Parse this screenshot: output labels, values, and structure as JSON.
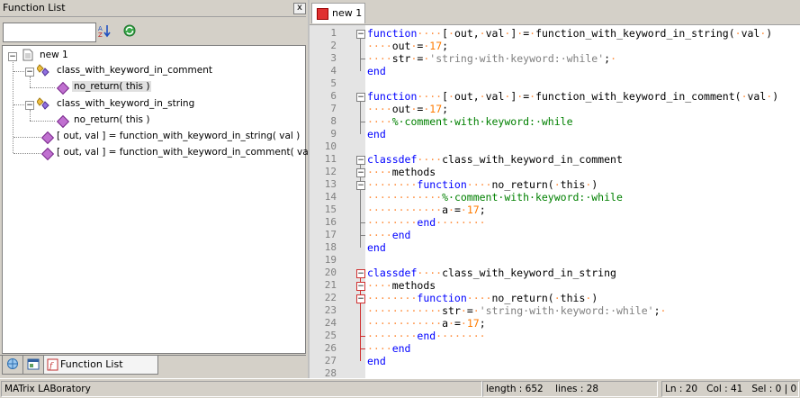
{
  "left_panel": {
    "title": "Function List",
    "close_label": "x",
    "search_value": "",
    "tree": {
      "root": "new 1",
      "classes": [
        {
          "label": "class_with_keyword_in_comment",
          "methods": [
            "no_return( this )"
          ]
        },
        {
          "label": "class_with_keyword_in_string",
          "methods": [
            "no_return( this )"
          ]
        }
      ],
      "functions": [
        "[ out, val ] = function_with_keyword_in_string( val )",
        "[ out, val ] = function_with_keyword_in_comment( val )"
      ]
    },
    "bottom_tabs": [
      {
        "icon": "globe-icon"
      },
      {
        "icon": "window-icon"
      },
      {
        "icon": "function-icon",
        "label": "Function List"
      }
    ]
  },
  "editor": {
    "tab_label": "new 1",
    "line_numbers": [
      "1",
      "2",
      "3",
      "4",
      "5",
      "6",
      "7",
      "8",
      "9",
      "10",
      "11",
      "12",
      "13",
      "14",
      "15",
      "16",
      "17",
      "18",
      "19",
      "20",
      "21",
      "22",
      "23",
      "24",
      "25",
      "26",
      "27",
      "28"
    ],
    "lines": [
      [
        {
          "t": "kw",
          "v": "function"
        },
        {
          "t": "dot",
          "v": "····"
        },
        {
          "t": "op",
          "v": "["
        },
        {
          "t": "dot",
          "v": "·"
        },
        {
          "t": "op",
          "v": "out,"
        },
        {
          "t": "dot",
          "v": "·"
        },
        {
          "t": "op",
          "v": "val"
        },
        {
          "t": "dot",
          "v": "·"
        },
        {
          "t": "op",
          "v": "]"
        },
        {
          "t": "dot",
          "v": "·"
        },
        {
          "t": "op",
          "v": "="
        },
        {
          "t": "dot",
          "v": "·"
        },
        {
          "t": "op",
          "v": "function_with_keyword_in_string("
        },
        {
          "t": "dot",
          "v": "·"
        },
        {
          "t": "op",
          "v": "val"
        },
        {
          "t": "dot",
          "v": "·"
        },
        {
          "t": "op",
          "v": ")"
        }
      ],
      [
        {
          "t": "dot",
          "v": "····"
        },
        {
          "t": "op",
          "v": "out"
        },
        {
          "t": "dot",
          "v": "·"
        },
        {
          "t": "op",
          "v": "="
        },
        {
          "t": "dot",
          "v": "·"
        },
        {
          "t": "num",
          "v": "17"
        },
        {
          "t": "op",
          "v": ";"
        }
      ],
      [
        {
          "t": "dot",
          "v": "····"
        },
        {
          "t": "op",
          "v": "str"
        },
        {
          "t": "dot",
          "v": "·"
        },
        {
          "t": "op",
          "v": "="
        },
        {
          "t": "dot",
          "v": "·"
        },
        {
          "t": "str",
          "v": "'string·with·keyword:·while'"
        },
        {
          "t": "op",
          "v": ";"
        },
        {
          "t": "dot",
          "v": "·"
        }
      ],
      [
        {
          "t": "kw",
          "v": "end"
        }
      ],
      [],
      [
        {
          "t": "kw",
          "v": "function"
        },
        {
          "t": "dot",
          "v": "····"
        },
        {
          "t": "op",
          "v": "["
        },
        {
          "t": "dot",
          "v": "·"
        },
        {
          "t": "op",
          "v": "out,"
        },
        {
          "t": "dot",
          "v": "·"
        },
        {
          "t": "op",
          "v": "val"
        },
        {
          "t": "dot",
          "v": "·"
        },
        {
          "t": "op",
          "v": "]"
        },
        {
          "t": "dot",
          "v": "·"
        },
        {
          "t": "op",
          "v": "="
        },
        {
          "t": "dot",
          "v": "·"
        },
        {
          "t": "op",
          "v": "function_with_keyword_in_comment("
        },
        {
          "t": "dot",
          "v": "·"
        },
        {
          "t": "op",
          "v": "val"
        },
        {
          "t": "dot",
          "v": "·"
        },
        {
          "t": "op",
          "v": ")"
        }
      ],
      [
        {
          "t": "dot",
          "v": "····"
        },
        {
          "t": "op",
          "v": "out"
        },
        {
          "t": "dot",
          "v": "·"
        },
        {
          "t": "op",
          "v": "="
        },
        {
          "t": "dot",
          "v": "·"
        },
        {
          "t": "num",
          "v": "17"
        },
        {
          "t": "op",
          "v": ";"
        }
      ],
      [
        {
          "t": "dot",
          "v": "····"
        },
        {
          "t": "cm",
          "v": "%·comment·with·keyword:·while"
        }
      ],
      [
        {
          "t": "kw",
          "v": "end"
        }
      ],
      [],
      [
        {
          "t": "kw",
          "v": "classdef"
        },
        {
          "t": "dot",
          "v": "····"
        },
        {
          "t": "op",
          "v": "class_with_keyword_in_comment"
        }
      ],
      [
        {
          "t": "dot",
          "v": "····"
        },
        {
          "t": "op",
          "v": "methods"
        }
      ],
      [
        {
          "t": "dot",
          "v": "········"
        },
        {
          "t": "kw",
          "v": "function"
        },
        {
          "t": "dot",
          "v": "····"
        },
        {
          "t": "op",
          "v": "no_return("
        },
        {
          "t": "dot",
          "v": "·"
        },
        {
          "t": "op",
          "v": "this"
        },
        {
          "t": "dot",
          "v": "·"
        },
        {
          "t": "op",
          "v": ")"
        }
      ],
      [
        {
          "t": "dot",
          "v": "············"
        },
        {
          "t": "cm",
          "v": "%·comment·with·keyword:·while"
        }
      ],
      [
        {
          "t": "dot",
          "v": "············"
        },
        {
          "t": "op",
          "v": "a"
        },
        {
          "t": "dot",
          "v": "·"
        },
        {
          "t": "op",
          "v": "="
        },
        {
          "t": "dot",
          "v": "·"
        },
        {
          "t": "num",
          "v": "17"
        },
        {
          "t": "op",
          "v": ";"
        }
      ],
      [
        {
          "t": "dot",
          "v": "········"
        },
        {
          "t": "kw",
          "v": "end"
        },
        {
          "t": "dot",
          "v": "········"
        }
      ],
      [
        {
          "t": "dot",
          "v": "····"
        },
        {
          "t": "kw",
          "v": "end"
        }
      ],
      [
        {
          "t": "kw",
          "v": "end"
        }
      ],
      [],
      [
        {
          "t": "kw",
          "v": "classdef"
        },
        {
          "t": "dot",
          "v": "····"
        },
        {
          "t": "op",
          "v": "class_with_keyword_in_string"
        }
      ],
      [
        {
          "t": "dot",
          "v": "····"
        },
        {
          "t": "op",
          "v": "methods"
        }
      ],
      [
        {
          "t": "dot",
          "v": "········"
        },
        {
          "t": "kw",
          "v": "function"
        },
        {
          "t": "dot",
          "v": "····"
        },
        {
          "t": "op",
          "v": "no_return("
        },
        {
          "t": "dot",
          "v": "·"
        },
        {
          "t": "op",
          "v": "this"
        },
        {
          "t": "dot",
          "v": "·"
        },
        {
          "t": "op",
          "v": ")"
        }
      ],
      [
        {
          "t": "dot",
          "v": "············"
        },
        {
          "t": "op",
          "v": "str"
        },
        {
          "t": "dot",
          "v": "·"
        },
        {
          "t": "op",
          "v": "="
        },
        {
          "t": "dot",
          "v": "·"
        },
        {
          "t": "str",
          "v": "'string·with·keyword:·while'"
        },
        {
          "t": "op",
          "v": ";"
        },
        {
          "t": "dot",
          "v": "·"
        }
      ],
      [
        {
          "t": "dot",
          "v": "············"
        },
        {
          "t": "op",
          "v": "a"
        },
        {
          "t": "dot",
          "v": "·"
        },
        {
          "t": "op",
          "v": "="
        },
        {
          "t": "dot",
          "v": "·"
        },
        {
          "t": "num",
          "v": "17"
        },
        {
          "t": "op",
          "v": ";"
        }
      ],
      [
        {
          "t": "dot",
          "v": "········"
        },
        {
          "t": "kw",
          "v": "end"
        },
        {
          "t": "dot",
          "v": "········"
        }
      ],
      [
        {
          "t": "dot",
          "v": "····"
        },
        {
          "t": "kw",
          "v": "end"
        }
      ],
      [
        {
          "t": "kw",
          "v": "end"
        }
      ],
      []
    ]
  },
  "status_bar": {
    "language": "MATrix LABoratory",
    "length": "length : 652",
    "lines": "lines : 28",
    "ln": "Ln : 20",
    "col": "Col : 41",
    "sel": "Sel : 0 | 0"
  },
  "colors": {
    "keyword": "#0000ff",
    "whitespace_dot": "#ff9040",
    "number": "#ff7b00",
    "string": "#808080",
    "comment": "#008000",
    "current_line": "#e8e8ff",
    "fold_marker_active": "#d03030"
  }
}
